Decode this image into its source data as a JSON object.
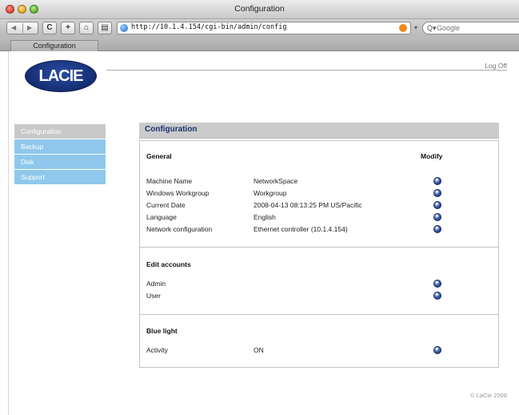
{
  "window": {
    "title": "Configuration"
  },
  "toolbar": {
    "back_icon": "back-arrow-icon",
    "forward_icon": "forward-arrow-icon",
    "reload_label": "C",
    "add_label": "+",
    "home_icon": "home-icon",
    "print_icon": "print-icon",
    "url": "http://10.1.4.154/cgi-bin/admin/config",
    "search_placeholder": "Google"
  },
  "tab": {
    "label": "Configuration"
  },
  "header": {
    "logo_text": "LACIE",
    "logoff_label": "Log Off"
  },
  "sidebar": {
    "items": [
      {
        "label": "Configuration",
        "active": true
      },
      {
        "label": "Backup",
        "active": false
      },
      {
        "label": "Disk",
        "active": false
      },
      {
        "label": "Support",
        "active": false
      }
    ]
  },
  "panel": {
    "title": "Configuration",
    "modify_header": "Modify",
    "sections": [
      {
        "title": "General",
        "rows": [
          {
            "label": "Machine Name",
            "value": "NetworkSpace"
          },
          {
            "label": "Windows Workgroup",
            "value": "Workgroup"
          },
          {
            "label": "Current Date",
            "value": "2008-04-13 08:13:25 PM US/Pacific"
          },
          {
            "label": "Language",
            "value": "English"
          },
          {
            "label": "Network configuration",
            "value": "Ethernet controller (10.1.4.154)"
          }
        ]
      },
      {
        "title": "Edit accounts",
        "rows": [
          {
            "label": "Admin",
            "value": ""
          },
          {
            "label": "User",
            "value": ""
          }
        ]
      },
      {
        "title": "Blue light",
        "rows": [
          {
            "label": "Activity",
            "value": "ON"
          }
        ]
      }
    ]
  },
  "footer": {
    "copyright": "© LaCie 2008"
  },
  "colors": {
    "sidebar_item": "#8fc8ec",
    "sidebar_active": "#c9c9c9",
    "panel_title": "#1e3170",
    "logo": "#1a3a8a"
  }
}
